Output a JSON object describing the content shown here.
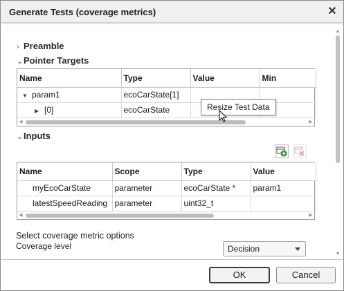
{
  "window": {
    "title": "Generate Tests (coverage metrics)"
  },
  "sections": {
    "preamble": "Preamble",
    "pointer_targets": "Pointer Targets",
    "inputs": "Inputs"
  },
  "pointer_table": {
    "columns": [
      "Name",
      "Type",
      "Value",
      "Min"
    ],
    "rows": [
      {
        "name": "param1",
        "type": "ecoCarState[1]",
        "value": "",
        "min": ""
      },
      {
        "name": "[0]",
        "type": "ecoCarState",
        "value": "",
        "min": ""
      }
    ]
  },
  "tooltip": {
    "text": "Resize Test Data"
  },
  "inputs_table": {
    "columns": [
      "Name",
      "Scope",
      "Type",
      "Value"
    ],
    "rows": [
      {
        "name": "myEcoCarState",
        "scope": "parameter",
        "type": "ecoCarState *",
        "value": "param1"
      },
      {
        "name": "latestSpeedReading",
        "scope": "parameter",
        "type": "uint32_t",
        "value": ""
      }
    ]
  },
  "coverage": {
    "heading": "Select coverage metric options",
    "level_label": "Coverage level",
    "level_value": "Decision"
  },
  "buttons": {
    "ok": "OK",
    "cancel": "Cancel"
  },
  "icons": {
    "add": "add-row-icon",
    "remove": "remove-row-icon",
    "close": "close-icon"
  },
  "colors": {
    "accent": "#5a7fb5",
    "add_icon": "#2e8b2e",
    "remove_icon": "#c0392b"
  }
}
